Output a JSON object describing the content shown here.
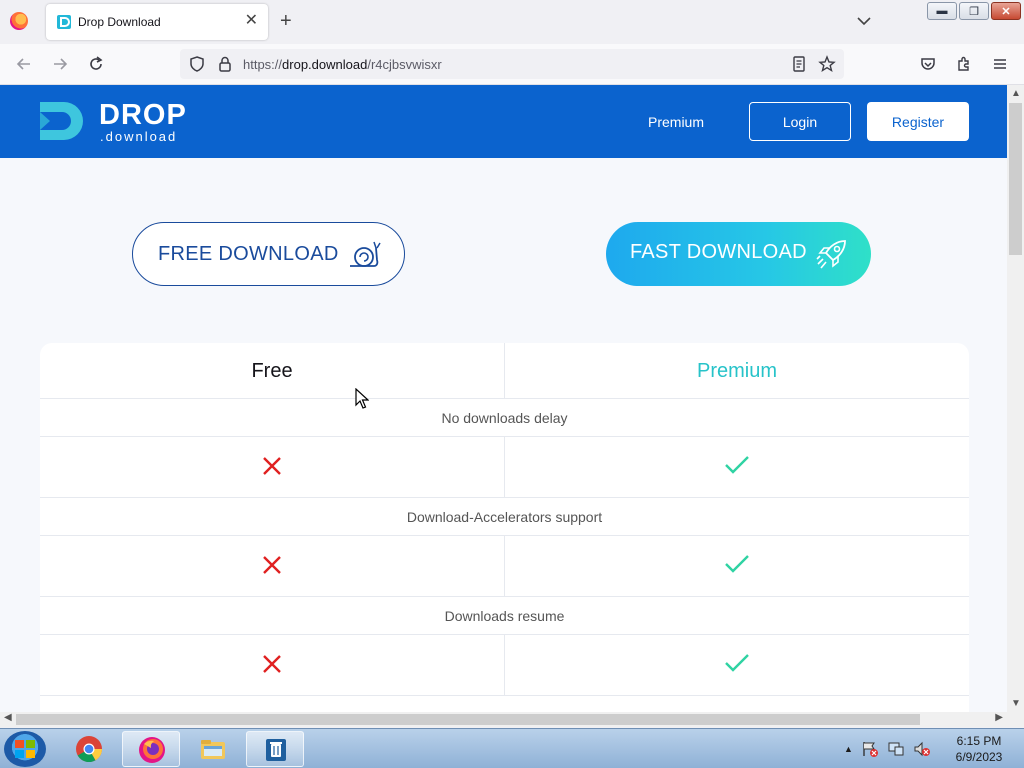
{
  "browser": {
    "tab_title": "Drop Download",
    "url_scheme": "https://",
    "url_host": "drop.download",
    "url_path": "/r4cjbsvwisxr"
  },
  "site": {
    "logo_text": "DROP",
    "logo_subtext": ".download",
    "nav": {
      "premium": "Premium",
      "login": "Login",
      "register": "Register"
    },
    "free_download_label": "FREE DOWNLOAD",
    "fast_download_label": "FAST DOWNLOAD",
    "comparison": {
      "free_header": "Free",
      "premium_header": "Premium",
      "features": [
        {
          "name": "No downloads delay",
          "free": false,
          "premium": true
        },
        {
          "name": "Download-Accelerators support",
          "free": false,
          "premium": true
        },
        {
          "name": "Downloads resume",
          "free": false,
          "premium": true
        }
      ]
    },
    "colors": {
      "header": "#0b63ce",
      "premium_text": "#27c3c9",
      "cross": "#e02020",
      "check": "#2fd3a3"
    }
  },
  "taskbar": {
    "apps": [
      "chrome-icon",
      "firefox-icon",
      "file-explorer-icon",
      "recycle-tool-icon"
    ],
    "time": "6:15 PM",
    "date": "6/9/2023"
  }
}
